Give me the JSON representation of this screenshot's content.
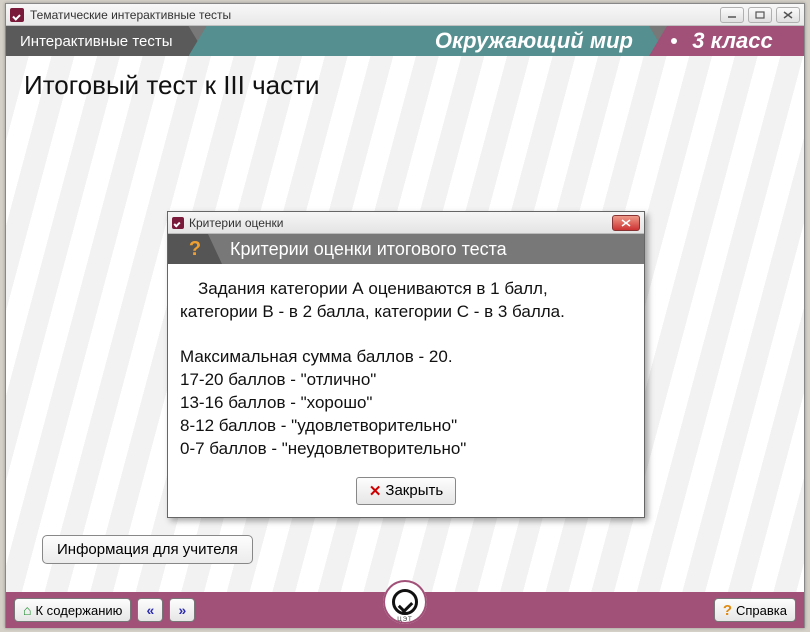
{
  "window": {
    "title": "Тематические интерактивные тесты"
  },
  "ribbon": {
    "left": "Интерактивные тесты",
    "subject": "Окружающий мир",
    "grade": "3 класс"
  },
  "page": {
    "title": "Итоговый тест к III части",
    "teacher_info_btn": "Информация для учителя"
  },
  "footer": {
    "to_contents": "К содержанию",
    "help": "Справка",
    "logo_caption": "ЦЭТ"
  },
  "modal": {
    "window_title": "Критерии оценки",
    "header": "Критерии оценки итогового теста",
    "line1": "Задания категории А оцениваются в 1 балл,",
    "line2": "категории В - в 2 балла, категории С - в 3 балла.",
    "max_line": "Максимальная сумма баллов  - 20.",
    "grade1": "17-20 баллов - \"отлично\"",
    "grade2": "13-16 баллов - \"хорошо\"",
    "grade3": "8-12 баллов - \"удовлетворительно\"",
    "grade4": "0-7 баллов - \"неудовлетворительно\"",
    "close_btn": "Закрыть"
  }
}
